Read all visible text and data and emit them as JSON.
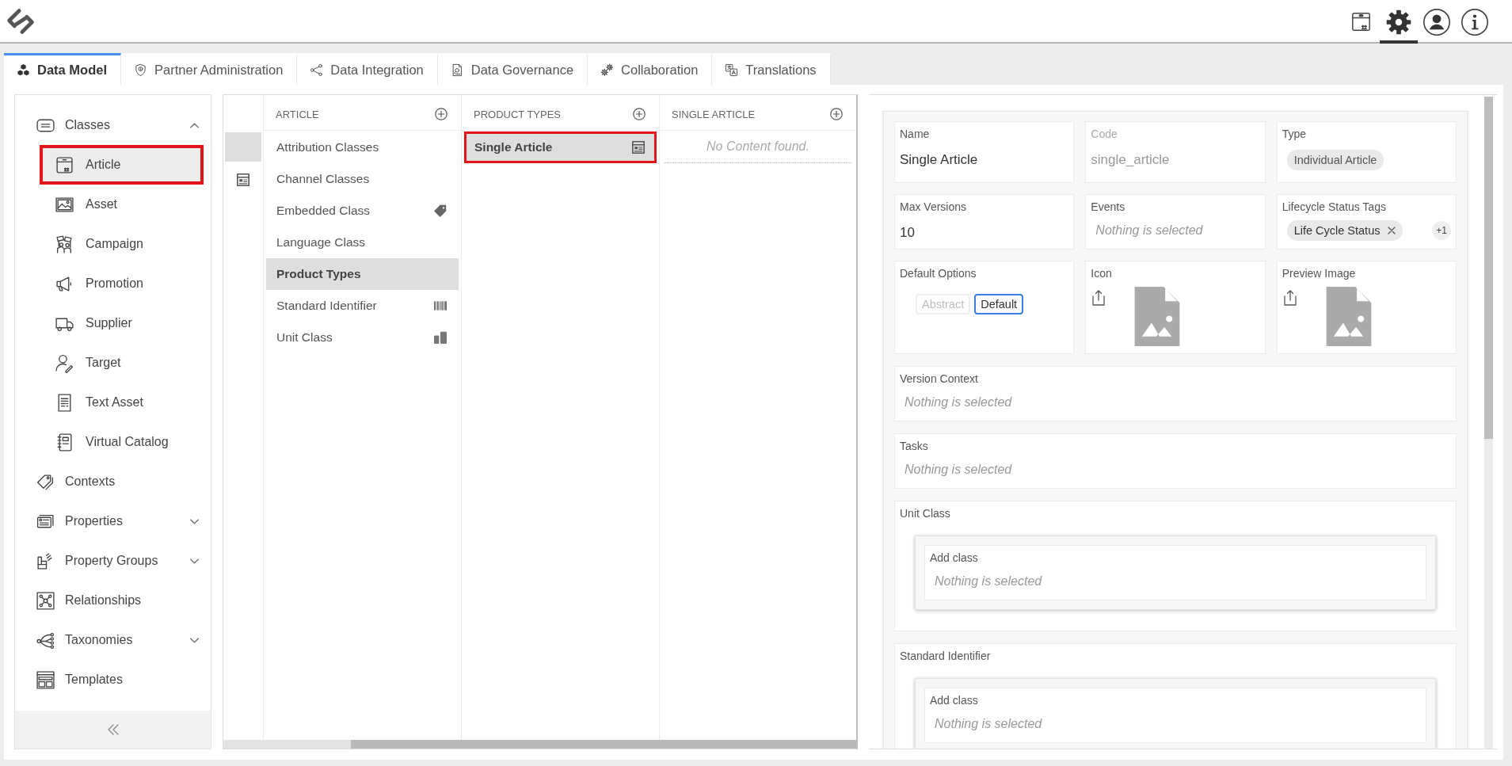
{
  "header": {
    "toolbar": [
      {
        "selected": false
      },
      {
        "selected": true
      },
      {
        "selected": false
      },
      {
        "selected": false
      }
    ]
  },
  "tabs": [
    {
      "label": "Data Model",
      "selected": true
    },
    {
      "label": "Partner Administration",
      "selected": false
    },
    {
      "label": "Data Integration",
      "selected": false
    },
    {
      "label": "Data Governance",
      "selected": false
    },
    {
      "label": "Collaboration",
      "selected": false
    },
    {
      "label": "Translations",
      "selected": false
    }
  ],
  "sidebar": {
    "items": [
      {
        "label": "Classes",
        "selected": false,
        "highlighted": false,
        "expanded": true,
        "children": [
          {
            "label": "Article",
            "selected": true,
            "highlighted": true
          },
          {
            "label": "Asset",
            "selected": false,
            "highlighted": false
          },
          {
            "label": "Campaign",
            "selected": false,
            "highlighted": false
          },
          {
            "label": "Promotion",
            "selected": false,
            "highlighted": false
          },
          {
            "label": "Supplier",
            "selected": false,
            "highlighted": false
          },
          {
            "label": "Target",
            "selected": false,
            "highlighted": false
          },
          {
            "label": "Text Asset",
            "selected": false,
            "highlighted": false
          },
          {
            "label": "Virtual Catalog",
            "selected": false,
            "highlighted": false
          }
        ]
      },
      {
        "label": "Contexts",
        "selected": false,
        "highlighted": false
      },
      {
        "label": "Properties",
        "selected": false,
        "highlighted": false,
        "expanded": false
      },
      {
        "label": "Property Groups",
        "selected": false,
        "highlighted": false,
        "expanded": false
      },
      {
        "label": "Relationships",
        "selected": false,
        "highlighted": false
      },
      {
        "label": "Taxonomies",
        "selected": false,
        "highlighted": false,
        "expanded": false
      },
      {
        "label": "Templates",
        "selected": false,
        "highlighted": false
      }
    ]
  },
  "browser": {
    "strip": [
      {
        "selected": true
      },
      {
        "selected": false
      }
    ],
    "columns": [
      {
        "title": "ARTICLE",
        "items": [
          {
            "label": "Attribution Classes",
            "selected": false,
            "highlighted": false
          },
          {
            "label": "Channel Classes",
            "selected": false,
            "highlighted": false
          },
          {
            "label": "Embedded Class",
            "selected": false,
            "highlighted": false
          },
          {
            "label": "Language Class",
            "selected": false,
            "highlighted": false
          },
          {
            "label": "Product Types",
            "selected": true,
            "highlighted": false
          },
          {
            "label": "Standard Identifier",
            "selected": false,
            "highlighted": false
          },
          {
            "label": "Unit Class",
            "selected": false,
            "highlighted": false
          }
        ]
      },
      {
        "title": "PRODUCT TYPES",
        "items": [
          {
            "label": "Single Article",
            "selected": true,
            "highlighted": true
          }
        ]
      },
      {
        "title": "SINGLE ARTICLE",
        "empty_text": "No Content found."
      }
    ]
  },
  "detail": {
    "grid": [
      {
        "kind": "text",
        "label": "Name",
        "value": "Single Article",
        "disabled": false
      },
      {
        "kind": "text",
        "label": "Code",
        "value": "single_article",
        "disabled": true
      },
      {
        "kind": "chip",
        "label": "Type",
        "chip": "Individual Article"
      },
      {
        "kind": "text",
        "label": "Max Versions",
        "value": "10",
        "disabled": false
      },
      {
        "kind": "select",
        "label": "Events",
        "placeholder": "Nothing is selected"
      },
      {
        "kind": "tags",
        "label": "Lifecycle Status Tags",
        "tags": [
          "Life Cycle Status"
        ],
        "more": "+1"
      },
      {
        "kind": "options",
        "label": "Default Options",
        "options": [
          {
            "label": "Abstract",
            "selected": false
          },
          {
            "label": "Default",
            "selected": true
          }
        ]
      },
      {
        "kind": "image",
        "label": "Icon"
      },
      {
        "kind": "image",
        "label": "Preview Image"
      }
    ],
    "sections": [
      {
        "kind": "select",
        "label": "Version Context",
        "placeholder": "Nothing is selected"
      },
      {
        "kind": "select",
        "label": "Tasks",
        "placeholder": "Nothing is selected"
      },
      {
        "kind": "nested",
        "label": "Unit Class",
        "field": {
          "label": "Add class",
          "placeholder": "Nothing is selected"
        }
      },
      {
        "kind": "nested",
        "label": "Standard Identifier",
        "field": {
          "label": "Add class",
          "placeholder": "Nothing is selected"
        }
      }
    ]
  }
}
